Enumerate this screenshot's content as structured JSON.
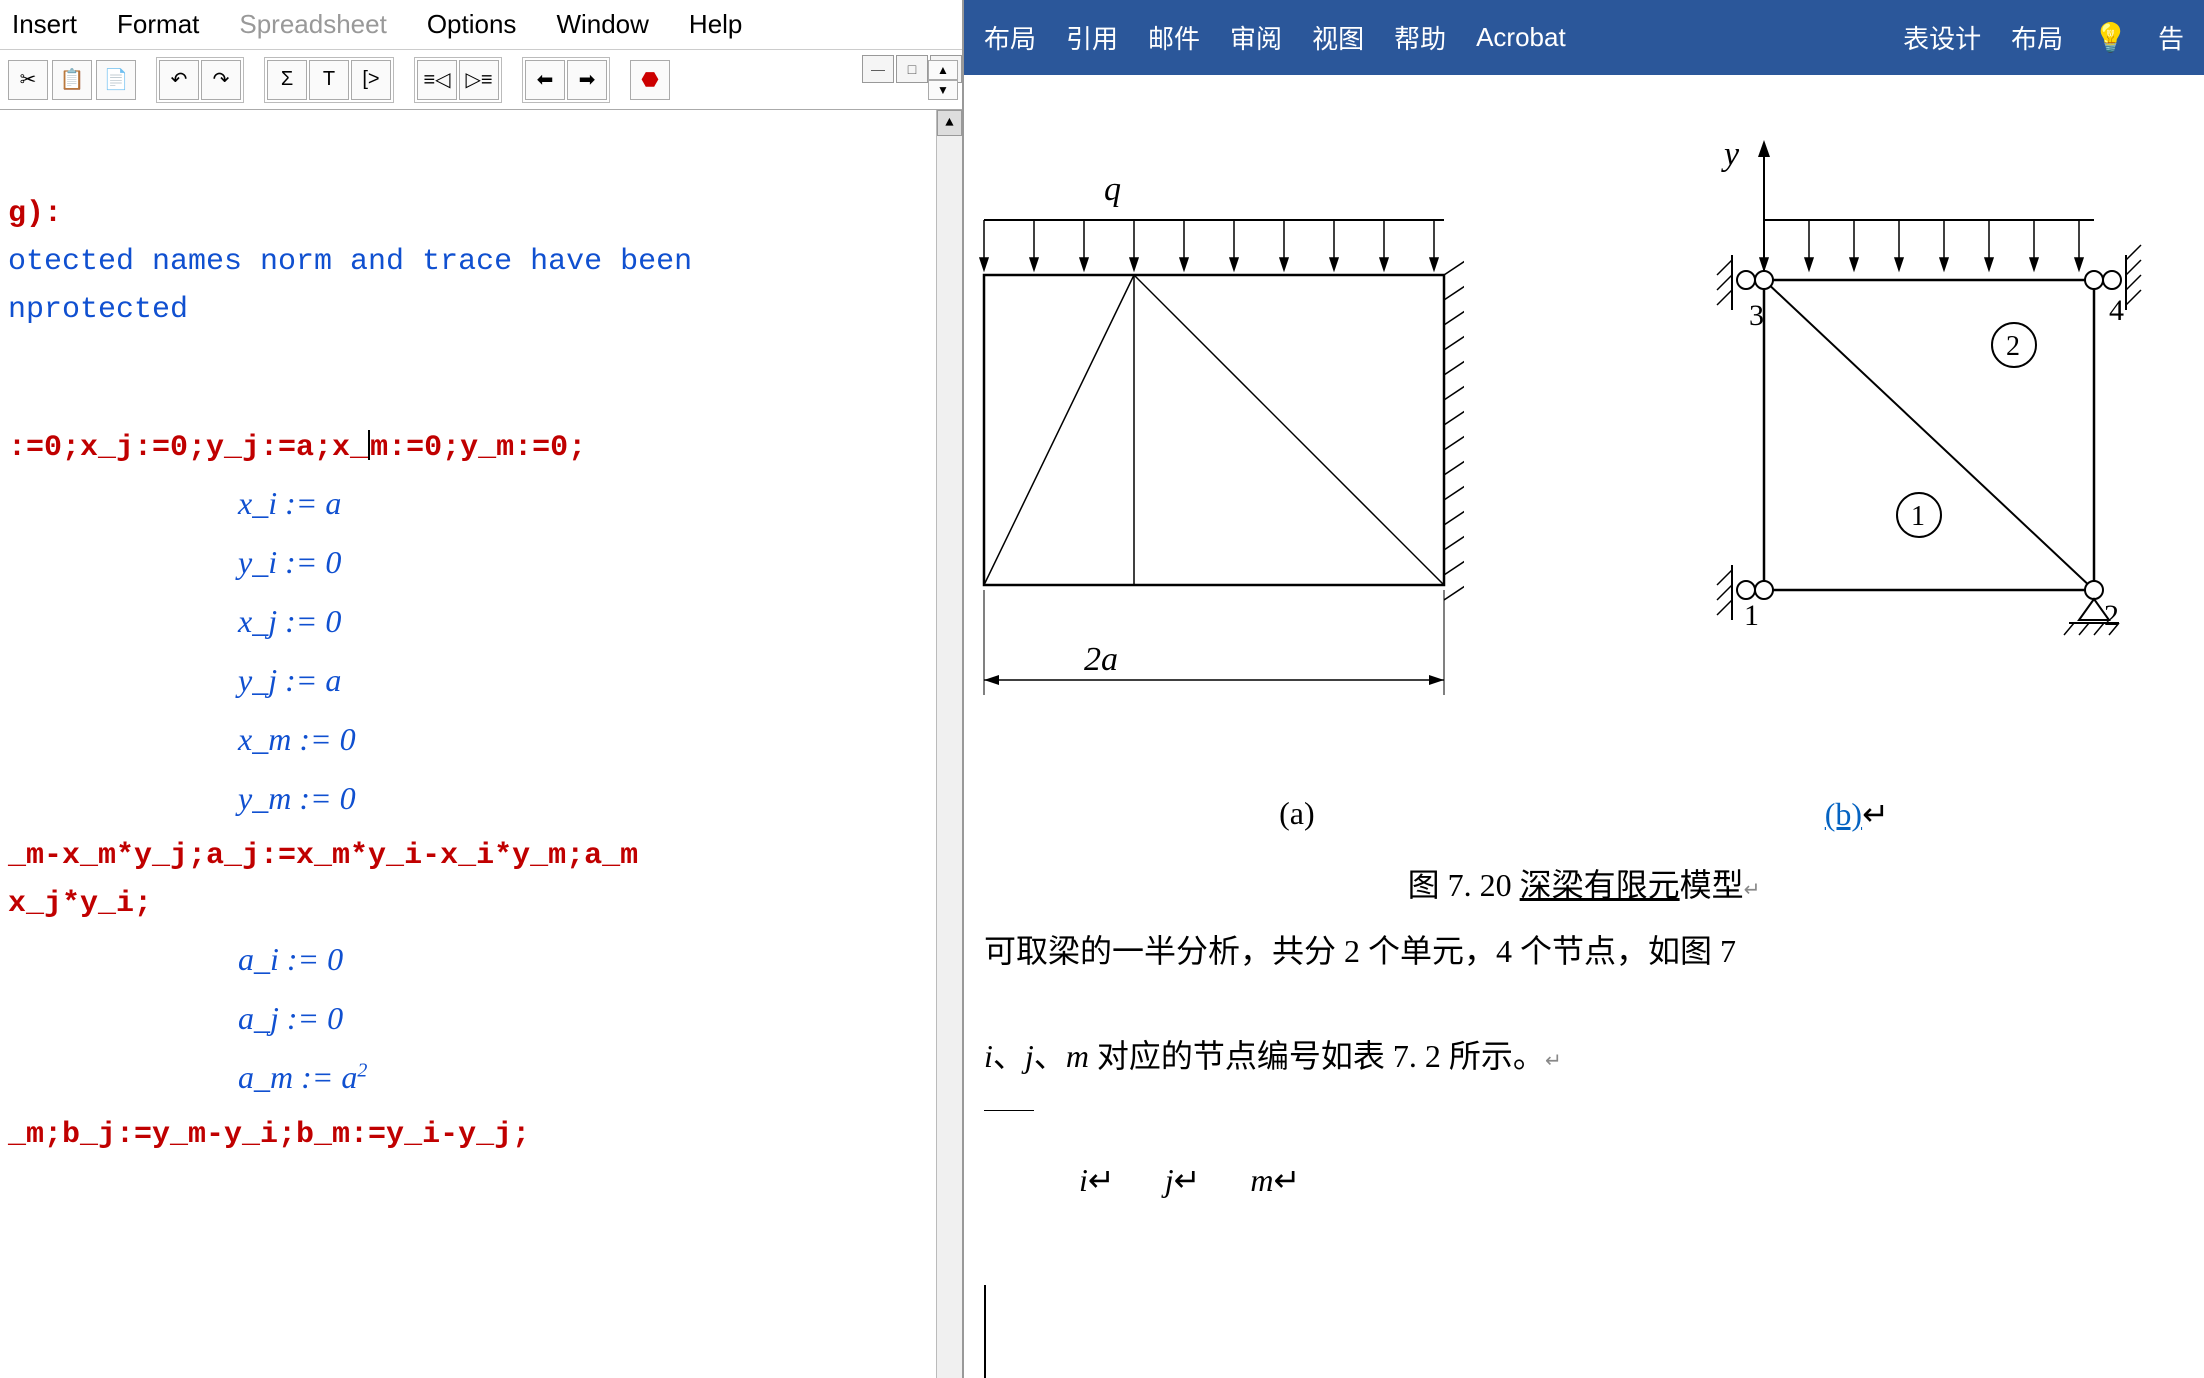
{
  "left_app": {
    "menu": {
      "insert": "Insert",
      "format": "Format",
      "spreadsheet": "Spreadsheet",
      "options": "Options",
      "window": "Window",
      "help": "Help"
    },
    "win_controls": {
      "minimize": "—",
      "maximize": "□",
      "close": "✕"
    },
    "worksheet": {
      "line1_prefix": "g):",
      "line2": "otected names norm and trace have been",
      "line3": "nprotected",
      "input_line": ":=0;x_j:=0;y_j:=a;x_m:=0;y_m:=0;",
      "input_before_cursor": ":=0;x_j:=0;y_j:=a;x_",
      "input_after_cursor": "m:=0;y_m:=0;",
      "results": {
        "r1": "x_i := a",
        "r2": "y_i := 0",
        "r3": "x_j := 0",
        "r4": "y_j := a",
        "r5": "x_m := 0",
        "r6": "y_m := 0"
      },
      "code_line2": "_m-x_m*y_j;a_j:=x_m*y_i-x_i*y_m;a_m",
      "code_line3": "x_j*y_i;",
      "results2": {
        "r1": "a_i := 0",
        "r2": "a_j := 0",
        "r3_base": "a_m := a",
        "r3_sup": "2"
      },
      "code_line4": "_m;b_j:=y_m-y_i;b_m:=y_i-y_j;"
    }
  },
  "right_app": {
    "ribbon": {
      "layout1": "布局",
      "reference": "引用",
      "mail": "邮件",
      "review": "审阅",
      "view": "视图",
      "help": "帮助",
      "acrobat": "Acrobat",
      "table_design": "表设计",
      "layout2": "布局",
      "tell": "告"
    },
    "figure_a": {
      "load_label": "q",
      "dimension": "2a"
    },
    "figure_b": {
      "y_axis": "y",
      "node1": "1",
      "node2": "2",
      "node3": "3",
      "node4": "4",
      "elem1": "1",
      "elem2": "2"
    },
    "captions": {
      "a": "(a)",
      "b": "(b)"
    },
    "figure_title_prefix": "图 7. 20  ",
    "figure_title_link": "深梁有限元",
    "figure_title_suffix": "模型",
    "body1": "可取梁的一半分析，共分 2 个单元，4 个节点，如图 7",
    "body2_prefix": "i、j、m ",
    "body2_i": "i",
    "body2_sep1": "、",
    "body2_j": "j",
    "body2_sep2": "、",
    "body2_m": "m",
    "body2_text": " 对应的节点编号如表 7. 2 所示。",
    "table_headers": {
      "i": "i",
      "j": "j",
      "m": "m"
    },
    "return_glyph": "↵"
  }
}
